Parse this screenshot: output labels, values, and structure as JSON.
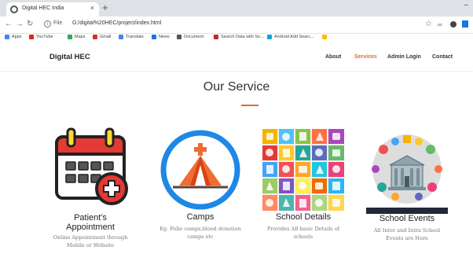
{
  "browser": {
    "tab_title": "Digital HEC India",
    "tab_close": "×",
    "new_tab": "+",
    "minimize": "–",
    "url_prefix": "File",
    "url": "G:/digital%20HEC/project/index.html",
    "bookmarks": [
      {
        "label": "Apps",
        "color": "#4285f4"
      },
      {
        "label": "YouTube",
        "color": "#e62117"
      },
      {
        "label": "Maps",
        "color": "#34a853"
      },
      {
        "label": "Gmail",
        "color": "#d93025"
      },
      {
        "label": "Translate",
        "color": "#4285f4"
      },
      {
        "label": "News",
        "color": "#1a73e8"
      },
      {
        "label": "Document",
        "color": "#555555"
      },
      {
        "label": "Search Data with Se...",
        "color": "#c62828"
      },
      {
        "label": "Android Add Searc...",
        "color": "#00a7e0"
      }
    ]
  },
  "site": {
    "brand": "Digital HEC",
    "nav": [
      "About",
      "Services",
      "Admin Login",
      "Contact"
    ],
    "active_nav": "Services",
    "accent_color": "#e06a3b"
  },
  "section": {
    "title": "Our Service",
    "cards": [
      {
        "title_line1": "Patient's",
        "title_line2": "Appointment",
        "desc_line1": "Online Appointment through",
        "desc_line2": "Mobile or Website",
        "icon": "calendar-medical-icon"
      },
      {
        "title_line1": "Camps",
        "title_line2": "",
        "desc_line1": "Eg. Polio camps,blood donation",
        "desc_line2": "camps etc",
        "icon": "medical-tent-icon"
      },
      {
        "title_line1": "School Details",
        "title_line2": "",
        "desc_line1": "Provides All basic Details of",
        "desc_line2": "schools",
        "icon": "school-supplies-grid-icon"
      },
      {
        "title_line1": "School Events",
        "title_line2": "",
        "desc_line1": "All Inter and Intra School",
        "desc_line2": "Events are Here",
        "icon": "school-events-illustration-icon"
      }
    ]
  }
}
